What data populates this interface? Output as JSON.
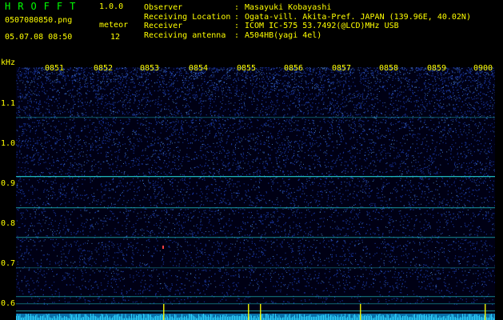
{
  "header": {
    "app_title": "HROFFT",
    "version": "1.0.0",
    "filename": "0507080850.png",
    "datetime": "05.07.08 08:50",
    "meteor_label": "meteor",
    "meteor_count": "12"
  },
  "info": [
    {
      "key": "Observer",
      "value": "Masayuki Kobayashi"
    },
    {
      "key": "Receiving Location",
      "value": "Ogata-vill. Akita-Pref. JAPAN (139.96E, 40.02N)"
    },
    {
      "key": "Receiver",
      "value": "ICOM IC-575 53.7492(@LCD)MHz USB"
    },
    {
      "key": "Receiving antenna",
      "value": "A504HB(yagi 4el)"
    }
  ],
  "axis": {
    "y_unit": "kHz",
    "y_ticks": [
      "1.1",
      "1.0",
      "0.9",
      "0.8",
      "0.7",
      "0.6"
    ],
    "x_ticks": [
      "0851",
      "0852",
      "0853",
      "0854",
      "0855",
      "0856",
      "0857",
      "0858",
      "0859",
      "0900"
    ]
  },
  "colors": {
    "background": "#000000",
    "text": "#ffff00",
    "title": "#00ff00",
    "noise": "#1a3aa8",
    "carrier": "#20c8c8",
    "meteor": "#ffff00"
  }
}
